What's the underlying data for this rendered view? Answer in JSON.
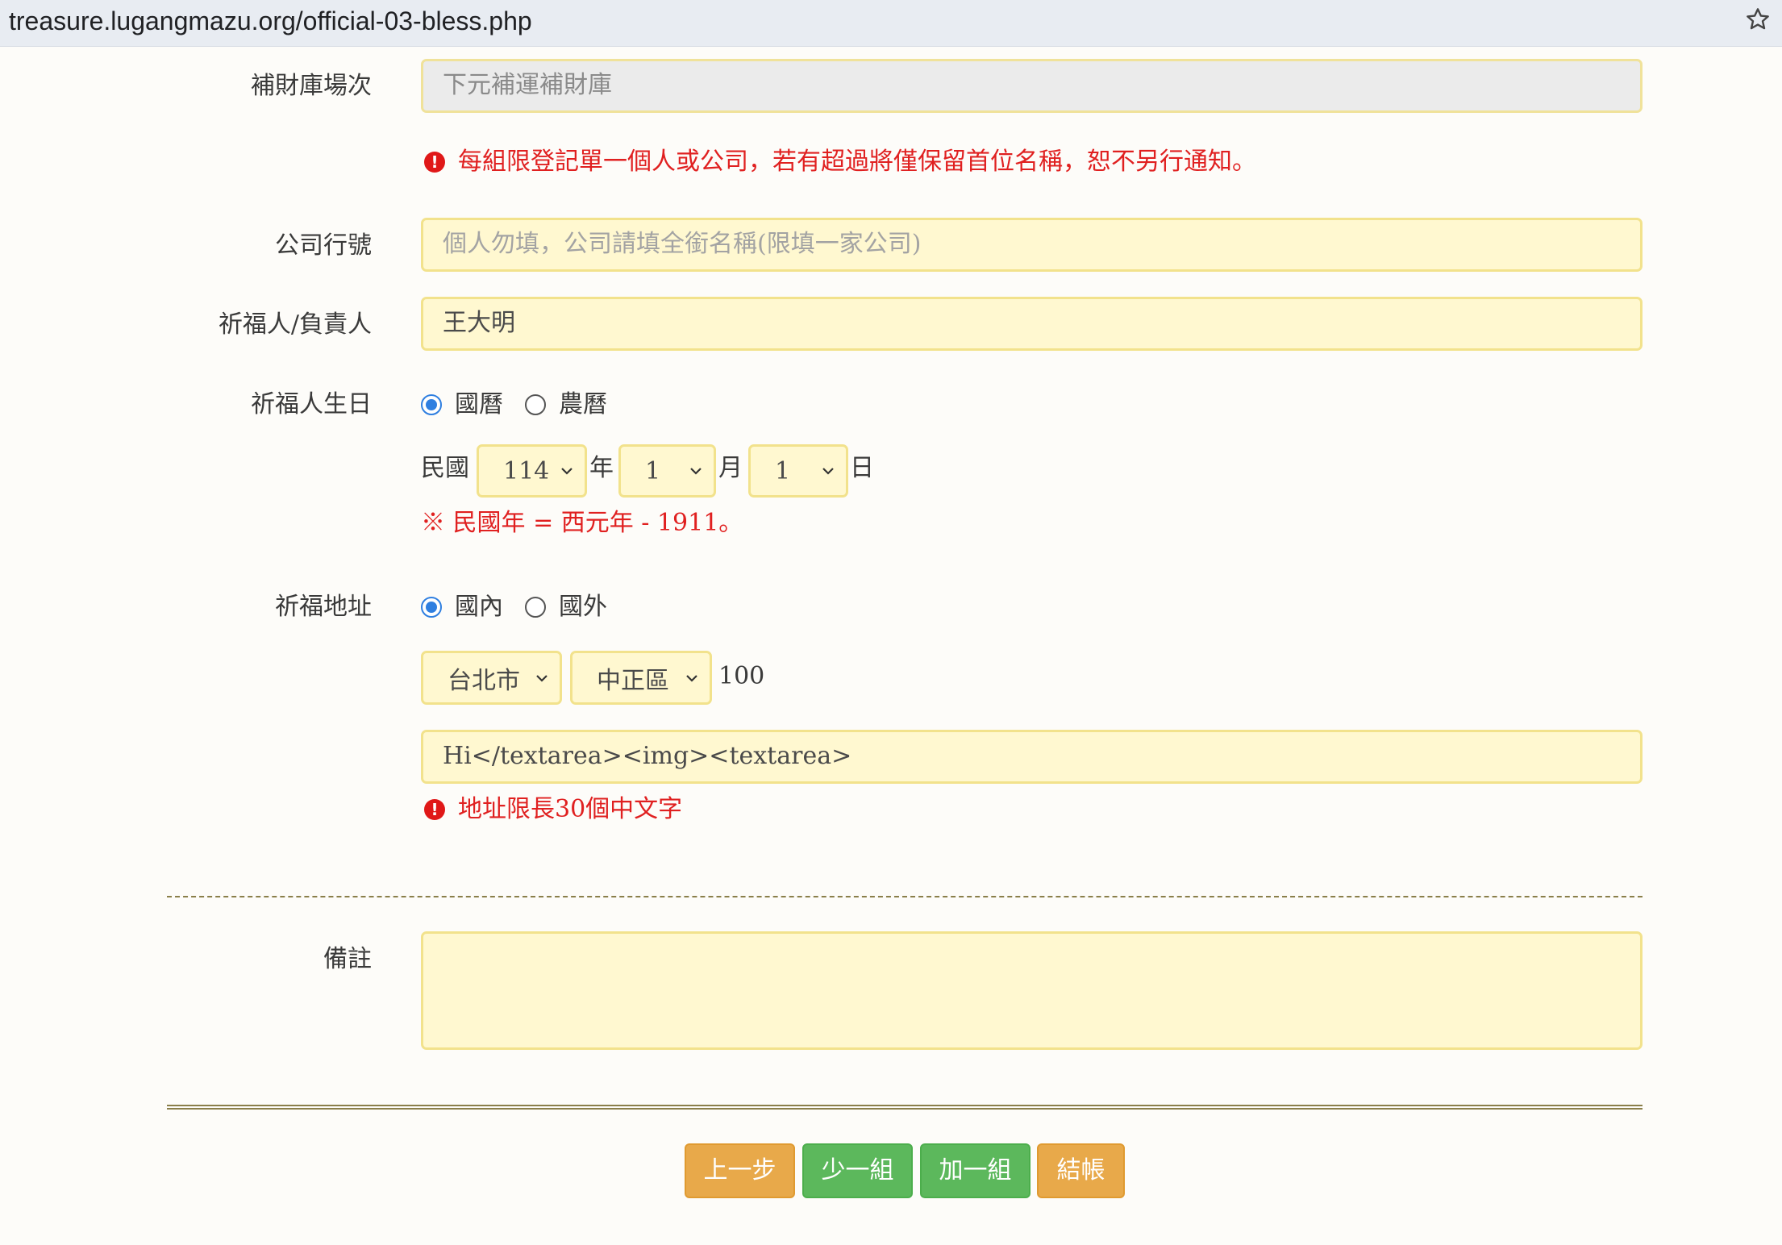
{
  "browser": {
    "url": "treasure.lugangmazu.org/official-03-bless.php"
  },
  "form": {
    "session": {
      "label": "補財庫場次",
      "value": "下元補運補財庫"
    },
    "notice": "每組限登記單一個人或公司，若有超過將僅保留首位名稱，恕不另行通知。",
    "company": {
      "label": "公司行號",
      "placeholder": "個人勿填，公司請填全銜名稱(限填一家公司)"
    },
    "blesser": {
      "label": "祈福人/負責人",
      "value": "王大明"
    },
    "birthday": {
      "label": "祈福人生日",
      "calendar_options": [
        "國曆",
        "農曆"
      ],
      "calendar_selected": "國曆",
      "prefix": "民國",
      "year": "114",
      "year_unit": "年",
      "month": "1",
      "month_unit": "月",
      "day": "1",
      "day_unit": "日",
      "note": "※ 民國年 = 西元年 - 1911。"
    },
    "address": {
      "label": "祈福地址",
      "region_options": [
        "國內",
        "國外"
      ],
      "region_selected": "國內",
      "city": "台北市",
      "district": "中正區",
      "zipcode": "100",
      "street": "Hi</textarea><img><textarea>",
      "error": "地址限長30個中文字"
    },
    "remarks": {
      "label": "備註",
      "value": ""
    }
  },
  "buttons": {
    "prev": "上一步",
    "remove_group": "少一組",
    "add_group": "加一組",
    "checkout": "結帳"
  },
  "colors": {
    "accent_orange": "#e8a94a",
    "accent_green": "#5cb85c",
    "error_red": "#e02020",
    "field_bg": "#fff8d0"
  }
}
